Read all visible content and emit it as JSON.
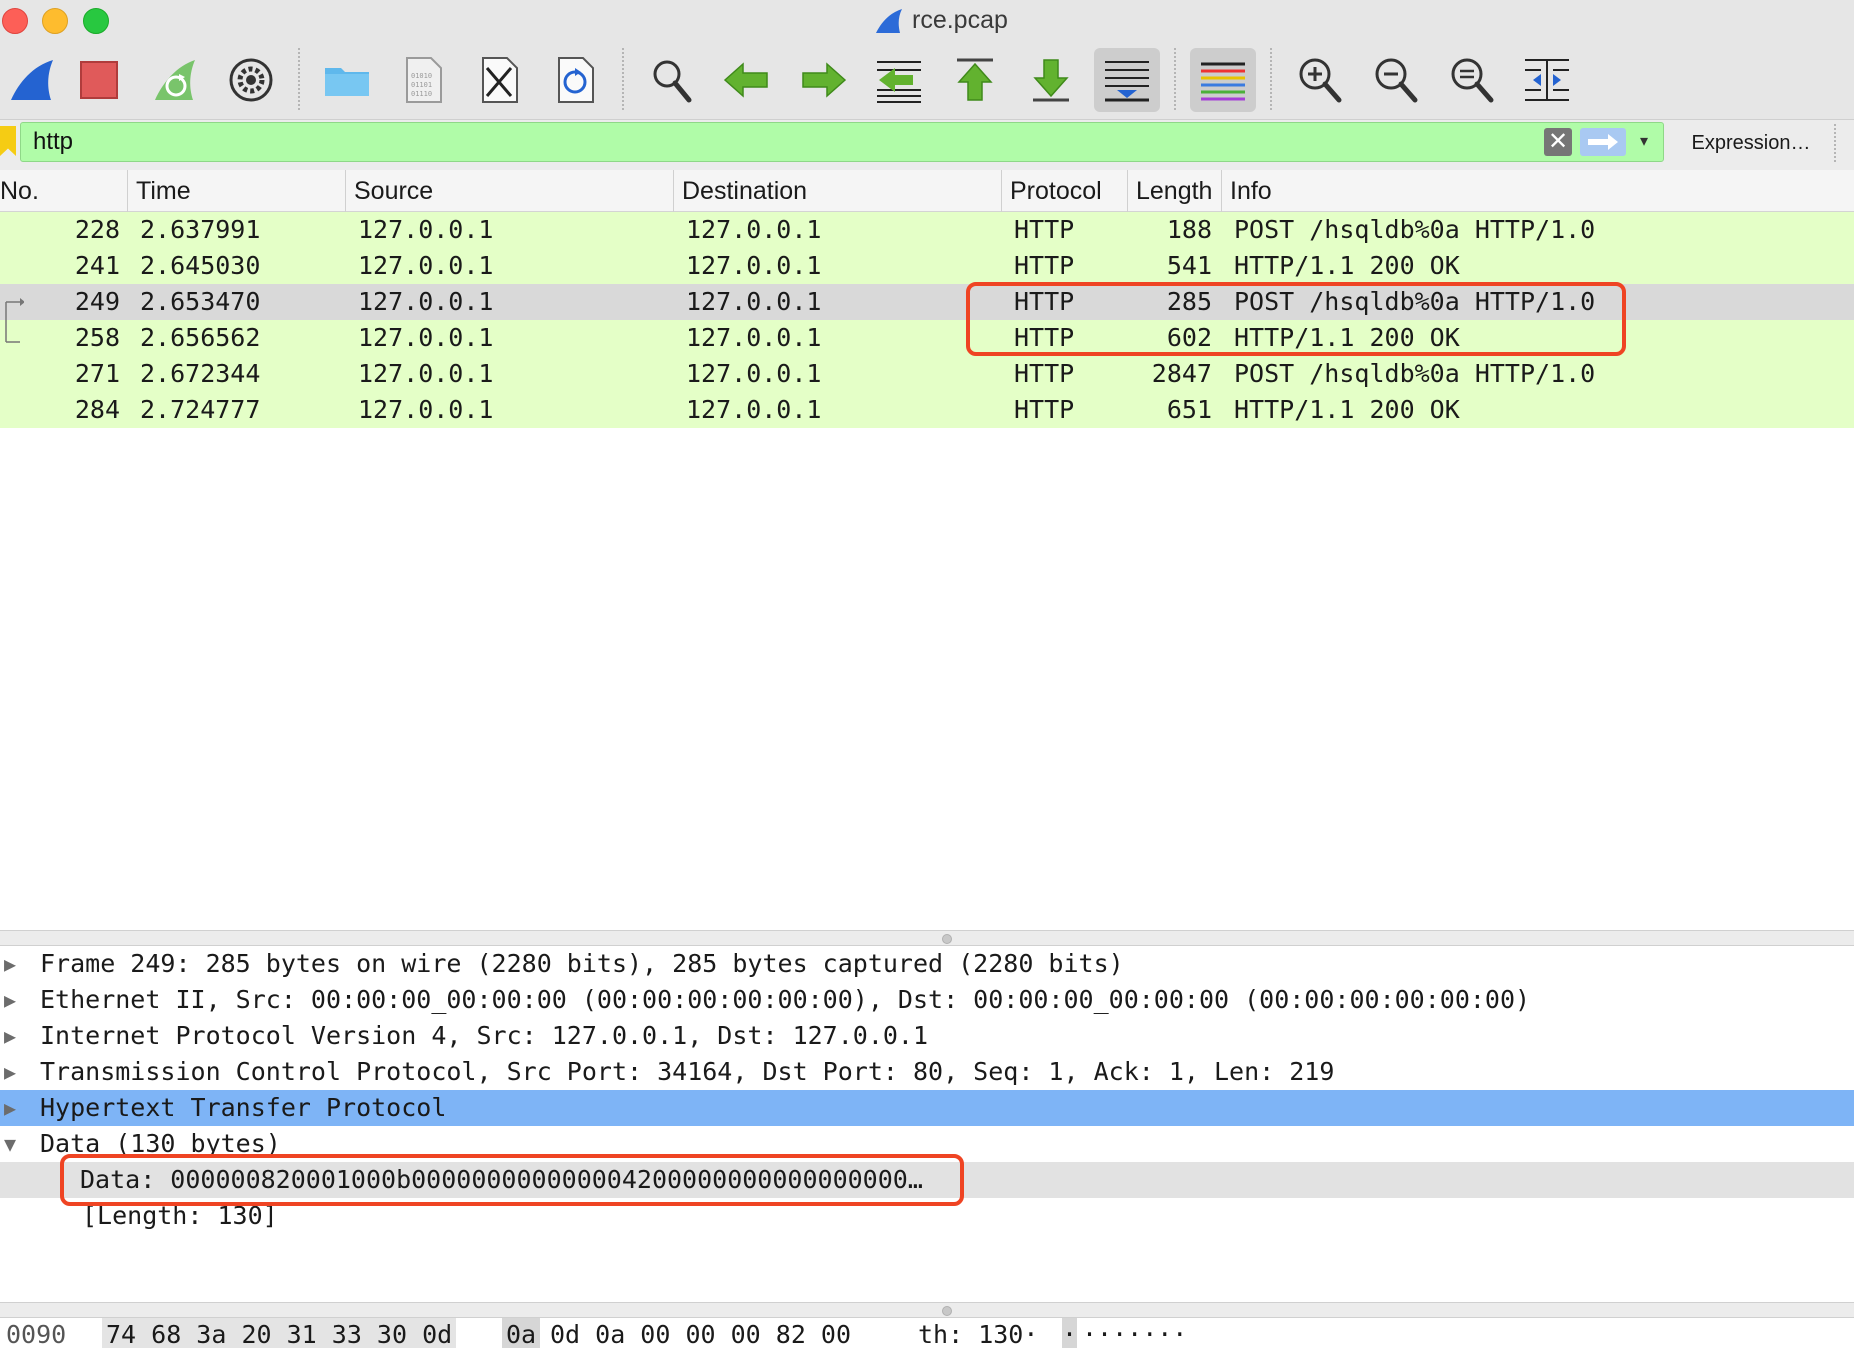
{
  "window": {
    "title": "rce.pcap"
  },
  "toolbar": {
    "buttons": [
      {
        "icon": "shark-fin-icon",
        "label": "start-capture"
      },
      {
        "icon": "stop-icon",
        "label": "stop-capture"
      },
      {
        "icon": "restart-icon",
        "label": "restart-capture"
      },
      {
        "icon": "gear-icon",
        "label": "capture-options"
      },
      {
        "icon": "folder-icon",
        "label": "open-file"
      },
      {
        "icon": "save-icon",
        "label": "save-file"
      },
      {
        "icon": "close-file-icon",
        "label": "close-file"
      },
      {
        "icon": "reload-icon",
        "label": "reload-file"
      },
      {
        "icon": "search-icon",
        "label": "find-packet"
      },
      {
        "icon": "arrow-left-icon",
        "label": "go-back"
      },
      {
        "icon": "arrow-right-icon",
        "label": "go-forward"
      },
      {
        "icon": "go-to-packet-icon",
        "label": "go-to-packet"
      },
      {
        "icon": "first-packet-icon",
        "label": "go-first"
      },
      {
        "icon": "last-packet-icon",
        "label": "go-last"
      },
      {
        "icon": "autoscroll-icon",
        "label": "autoscroll"
      },
      {
        "icon": "colorize-icon",
        "label": "colorize"
      },
      {
        "icon": "zoom-in-icon",
        "label": "zoom-in"
      },
      {
        "icon": "zoom-out-icon",
        "label": "zoom-out"
      },
      {
        "icon": "zoom-reset-icon",
        "label": "normal-size"
      },
      {
        "icon": "resize-columns-icon",
        "label": "resize-columns"
      }
    ]
  },
  "filter": {
    "value": "http",
    "clear_glyph": "✕",
    "dropdown_glyph": "▾",
    "expression_label": "Expression…"
  },
  "packet_list": {
    "columns": [
      "No.",
      "Time",
      "Source",
      "Destination",
      "Protocol",
      "Length",
      "Info"
    ],
    "rows": [
      {
        "no": "228",
        "time": "2.637991",
        "source": "127.0.0.1",
        "destination": "127.0.0.1",
        "protocol": "HTTP",
        "length": "188",
        "info": "POST /hsqldb%0a HTTP/1.0"
      },
      {
        "no": "241",
        "time": "2.645030",
        "source": "127.0.0.1",
        "destination": "127.0.0.1",
        "protocol": "HTTP",
        "length": "541",
        "info": "HTTP/1.1 200 OK"
      },
      {
        "no": "249",
        "time": "2.653470",
        "source": "127.0.0.1",
        "destination": "127.0.0.1",
        "protocol": "HTTP",
        "length": "285",
        "info": "POST /hsqldb%0a HTTP/1.0"
      },
      {
        "no": "258",
        "time": "2.656562",
        "source": "127.0.0.1",
        "destination": "127.0.0.1",
        "protocol": "HTTP",
        "length": "602",
        "info": "HTTP/1.1 200 OK"
      },
      {
        "no": "271",
        "time": "2.672344",
        "source": "127.0.0.1",
        "destination": "127.0.0.1",
        "protocol": "HTTP",
        "length": "2847",
        "info": "POST /hsqldb%0a HTTP/1.0"
      },
      {
        "no": "284",
        "time": "2.724777",
        "source": "127.0.0.1",
        "destination": "127.0.0.1",
        "protocol": "HTTP",
        "length": "651",
        "info": "HTTP/1.1 200 OK"
      }
    ],
    "selected_row": "249"
  },
  "details": {
    "rows": [
      {
        "expander": "▶",
        "text": "Frame 249: 285 bytes on wire (2280 bits), 285 bytes captured (2280 bits)"
      },
      {
        "expander": "▶",
        "text": "Ethernet II, Src: 00:00:00_00:00:00 (00:00:00:00:00:00), Dst: 00:00:00_00:00:00 (00:00:00:00:00:00)"
      },
      {
        "expander": "▶",
        "text": "Internet Protocol Version 4, Src: 127.0.0.1, Dst: 127.0.0.1"
      },
      {
        "expander": "▶",
        "text": "Transmission Control Protocol, Src Port: 34164, Dst Port: 80, Seq: 1, Ack: 1, Len: 219"
      },
      {
        "expander": "▶",
        "text": "Hypertext Transfer Protocol"
      },
      {
        "expander": "▼",
        "text": "Data (130 bytes)"
      },
      {
        "expander": "",
        "text": "Data: 000000820001000b000000000000004200000000000000000…"
      },
      {
        "expander": "",
        "text": "[Length: 130]"
      }
    ]
  },
  "bytes": {
    "offset": "0090",
    "hex_a": "74 68 3a 20 31 33 30 0d",
    "hex_sel": "0a",
    "hex_b": "0d 0a 00 00 00 82 00",
    "ascii_a": "th: 130·",
    "ascii_sel": "·",
    "ascii_b": "·······"
  },
  "colors": {
    "http_row": "#e4ffc7",
    "selected_row": "#d9d9d9",
    "tree_selected": "#7eb4f6",
    "filter_ok": "#b0fca8",
    "annotation": "#ef4423"
  }
}
